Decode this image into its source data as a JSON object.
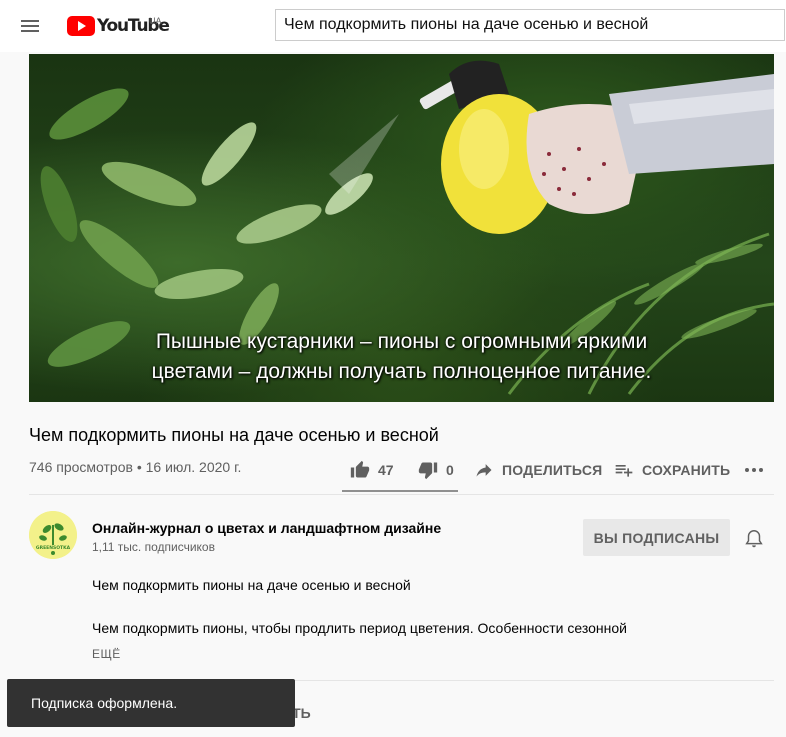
{
  "header": {
    "logo_text": "YouTube",
    "region": "UA",
    "search_value": "Чем подкормить пионы на даче осенью и весной"
  },
  "video": {
    "subtitle_line1": "Пышные кустарники – пионы с огромными яркими",
    "subtitle_line2": "цветами – должны получать полноценное питание."
  },
  "info": {
    "title": "Чем подкормить пионы на даче осенью и весной",
    "views_date": "746 просмотров • 16 июл. 2020 г.",
    "like_count": "47",
    "dislike_count": "0",
    "share_label": "ПОДЕЛИТЬСЯ",
    "save_label": "СОХРАНИТЬ",
    "like_ratio": 1.0
  },
  "channel": {
    "name": "Онлайн-журнал о цветах и ландшафтном дизайне",
    "subscribers": "1,11 тыс. подписчиков",
    "subscribed_label": "ВЫ ПОДПИСАНЫ",
    "avatar_text": "GREENSOTKA"
  },
  "description": {
    "line1": "Чем подкормить пионы на даче осенью и весной",
    "line2": "Чем подкормить пионы, чтобы продлить период цветения. Особенности сезонной",
    "more_label": "ЕЩЁ"
  },
  "below": {
    "partial_text": "ИТЬ"
  },
  "toast": {
    "message": "Подписка оформлена."
  },
  "colors": {
    "brand_red": "#ff0000",
    "toast_bg": "#323232",
    "subscribed_bg": "#e8e8e8"
  }
}
